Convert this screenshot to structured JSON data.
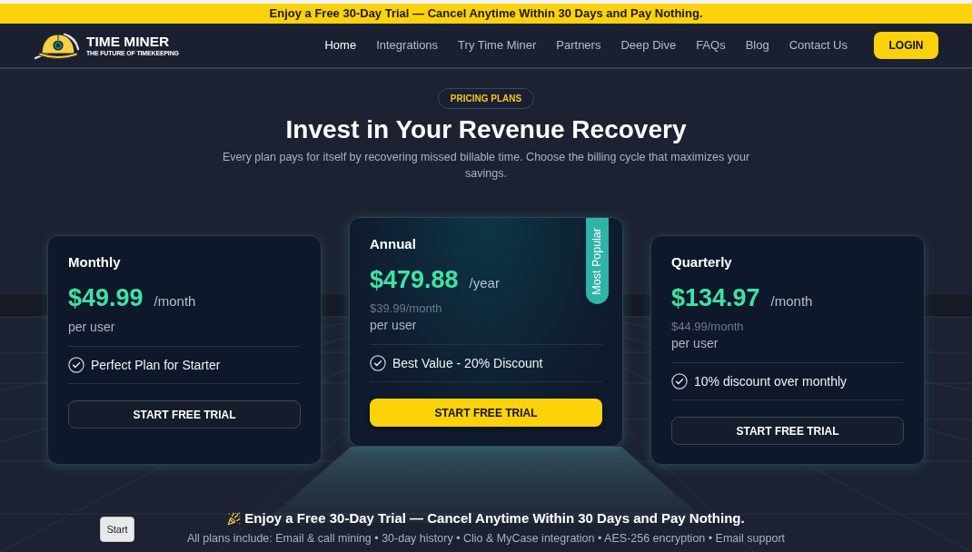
{
  "promo_banner": {
    "text": "Enjoy a Free 30-Day Trial — Cancel Anytime Within 30 Days and Pay Nothing."
  },
  "navbar": {
    "logo": {
      "name": "TIME MINER",
      "tagline": "THE FUTURE OF TIMEKEEPING"
    },
    "links": [
      {
        "label": "Home",
        "selected": true
      },
      {
        "label": "Integrations",
        "selected": false
      },
      {
        "label": "Try Time Miner",
        "selected": false
      },
      {
        "label": "Partners",
        "selected": false
      },
      {
        "label": "Deep Dive",
        "selected": false
      },
      {
        "label": "FAQs",
        "selected": false
      },
      {
        "label": "Blog",
        "selected": false
      },
      {
        "label": "Contact Us",
        "selected": false
      }
    ],
    "login_button": "LOGIN"
  },
  "hero": {
    "badge": "PRICING PLANS",
    "title": "Invest in Your Revenue Recovery",
    "subtitle": "Every plan pays for itself by recovering missed billable time. Choose the billing cycle that maximizes your savings."
  },
  "plans": [
    {
      "name": "Monthly",
      "price": "$49.99",
      "period": "/month",
      "per_user": "per user",
      "features": [
        "Perfect Plan for Starter"
      ],
      "button": "START FREE TRIAL",
      "featured": false
    },
    {
      "name": "Annual",
      "price": "$479.88",
      "period": "/year",
      "equivalent": "$39.99/month",
      "per_user": "per user",
      "features": [
        "Best Value - 20% Discount"
      ],
      "button": "START FREE TRIAL",
      "featured": true,
      "ribbon": "Most Popular"
    },
    {
      "name": "Quarterly",
      "price": "$134.97",
      "period": "/month",
      "equivalent": "$44.99/month",
      "per_user": "per user",
      "features": [
        "10% discount over monthly"
      ],
      "button": "START FREE TRIAL",
      "featured": false
    }
  ],
  "footer_note": {
    "button": "Start",
    "headline": "Enjoy a Free 30-Day Trial — Cancel Anytime Within 30 Days and Pay Nothing.",
    "includes": "All plans include: Email & call mining • 30-day history • Clio & MyCase integration • AES-256 encryption • Email support"
  }
}
